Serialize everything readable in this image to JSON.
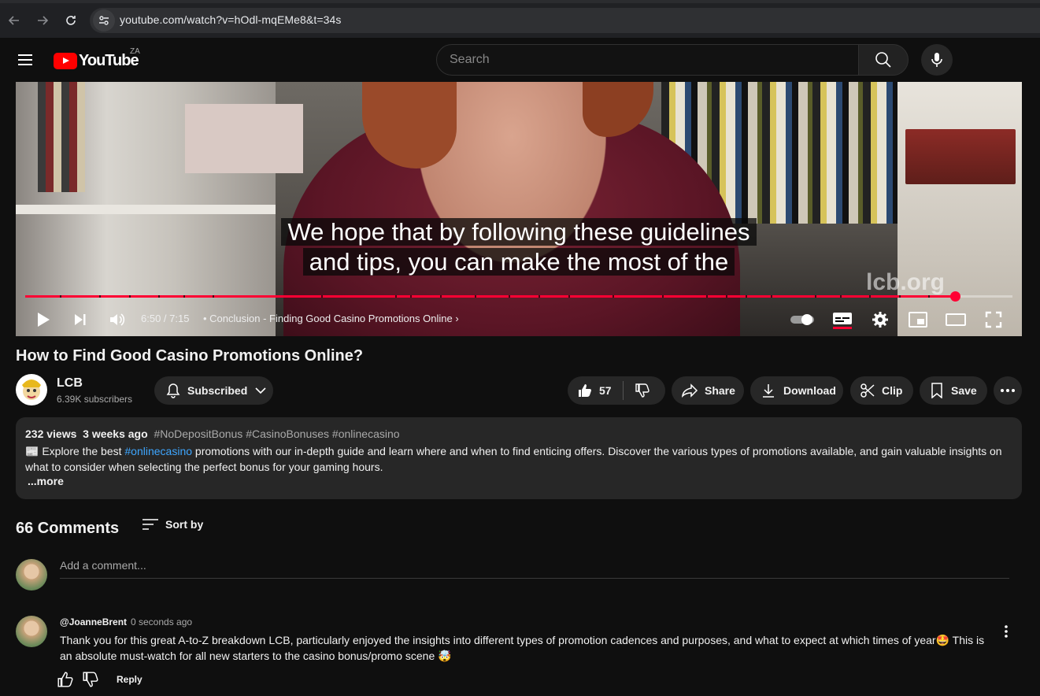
{
  "browser": {
    "url": "youtube.com/watch?v=hOdl-mqEMe8&t=34s"
  },
  "header": {
    "logo_text": "YouTube",
    "country_code": "ZA",
    "search_placeholder": "Search"
  },
  "player": {
    "caption_line1": "We hope that by following these guidelines",
    "caption_line2": "and tips, you can make the most of the",
    "watermark": "lcb.org",
    "time": "6:50 / 7:15",
    "chapter": "• Conclusion - Finding Good Casino Promotions Online",
    "progress_fraction": 0.942,
    "accent_color": "#ff0033"
  },
  "video": {
    "title": "How to Find Good Casino Promotions Online?"
  },
  "channel": {
    "name": "LCB",
    "subscribers": "6.39K subscribers",
    "subscribed_label": "Subscribed"
  },
  "actions": {
    "like_count": "57",
    "share": "Share",
    "download": "Download",
    "clip": "Clip",
    "save": "Save"
  },
  "description": {
    "views": "232 views",
    "date": "3 weeks ago",
    "tags": "#NoDepositBonus #CasinoBonuses #onlinecasino",
    "emoji": "📰",
    "text_before_link": " Explore the best ",
    "link": "#onlinecasino",
    "text_after_link": " promotions with our in-depth guide and learn where and when to find enticing offers. Discover the various types of promotions available, and gain valuable insights on what to consider when selecting the perfect bonus for your gaming hours.",
    "more": "...more"
  },
  "comments": {
    "count": "66 Comments",
    "sort_label": "Sort by",
    "add_placeholder": "Add a comment...",
    "items": [
      {
        "author": "@JoanneBrent",
        "time": "0 seconds ago",
        "text": "Thank you for this great A-to-Z breakdown LCB, particularly enjoyed the insights into different types of promotion cadences and purposes, and what to expect at which times of year🤩 This is an absolute must-watch for all new starters to the casino bonus/promo scene 🤯",
        "reply": "Reply"
      }
    ]
  }
}
